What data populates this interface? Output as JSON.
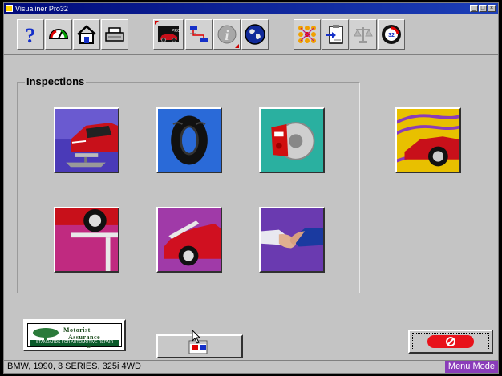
{
  "window": {
    "title": "Visualiner Pro32"
  },
  "toolbar": {
    "buttons": [
      {
        "name": "help",
        "icon": "question-mark-icon"
      },
      {
        "name": "gauge",
        "icon": "gauge-icon"
      },
      {
        "name": "home",
        "icon": "home-icon"
      },
      {
        "name": "print",
        "icon": "printer-icon"
      },
      {
        "name": "pro32-logo",
        "icon": "pro32-car-icon"
      },
      {
        "name": "hierarchy",
        "icon": "hierarchy-icon"
      },
      {
        "name": "info",
        "icon": "info-icon"
      },
      {
        "name": "globe",
        "icon": "globe-icon"
      },
      {
        "name": "network",
        "icon": "network-icon"
      },
      {
        "name": "clipboard",
        "icon": "clipboard-icon"
      },
      {
        "name": "scale",
        "icon": "scale-icon"
      },
      {
        "name": "pro32-badge",
        "icon": "pro32-badge-icon"
      }
    ]
  },
  "inspections": {
    "title": "Inspections",
    "tiles": [
      {
        "name": "lift-inspection",
        "icon": "car-on-lift-icon"
      },
      {
        "name": "tire-inspection",
        "icon": "tire-icon"
      },
      {
        "name": "brake-inspection",
        "icon": "brake-caliper-icon"
      },
      {
        "name": "suspension-inspection",
        "icon": "wheel-on-lift-icon"
      },
      {
        "name": "hood-inspection",
        "icon": "car-hood-open-icon"
      },
      {
        "name": "handshake",
        "icon": "handshake-icon"
      }
    ]
  },
  "side_tile": {
    "name": "alignment-vibration",
    "icon": "car-vibration-icon"
  },
  "map_logo": {
    "line1": "Motorist",
    "line2": "Assurance",
    "line3": "Program",
    "sub": "STANDARDS FOR AUTOMOTIVE REPAIR"
  },
  "status": {
    "vehicle": "BMW, 1990, 3 SERIES, 325i 4WD",
    "mode": "Menu Mode"
  }
}
